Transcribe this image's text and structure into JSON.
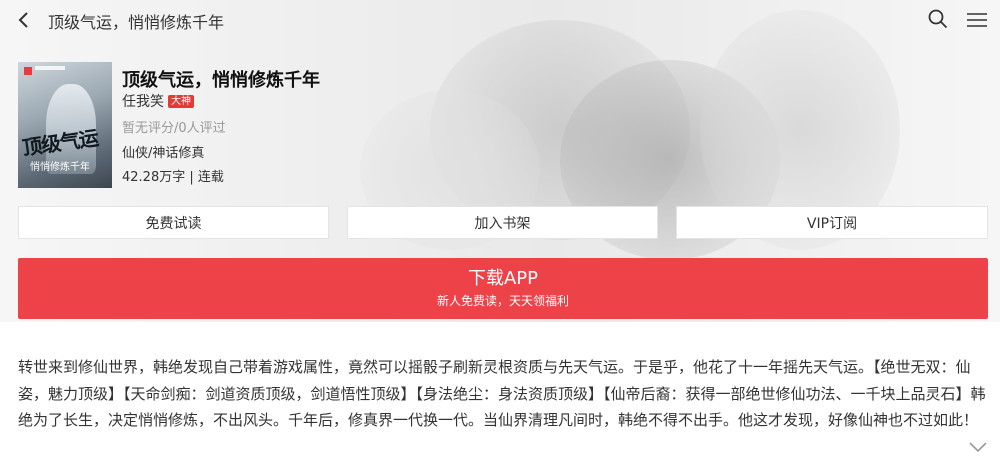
{
  "nav": {
    "title": "顶级气运，悄悄修炼千年",
    "icons": {
      "back": "chevron-left-icon",
      "search": "search-icon",
      "menu": "menu-icon"
    }
  },
  "book": {
    "title": "顶级气运，悄悄修炼千年",
    "author": "任我笑",
    "author_badge": "大神",
    "rating": "暂无评分/0人评过",
    "genre": "仙侠/神话修真",
    "stats": "42.28万字 | 连载",
    "cover": {
      "title_art": "顶级气运",
      "subtitle": "悄悄修炼千年"
    }
  },
  "actions": {
    "free_read": "免费试读",
    "add_shelf": "加入书架",
    "vip": "VIP订阅"
  },
  "download": {
    "label": "下载APP",
    "sub": "新人免费读，天天领福利"
  },
  "intro": {
    "text": "转世来到修仙世界，韩绝发现自己带着游戏属性，竟然可以摇骰子刷新灵根资质与先天气运。于是乎，他花了十一年摇先天气运。【绝世无双：仙姿，魅力顶级】【天命剑痴：剑道资质顶级，剑道悟性顶级】【身法绝尘：身法资质顶级】【仙帝后裔：获得一部绝世修仙功法、一千块上品灵石】韩绝为了长生，决定悄悄修炼，不出风头。千年后，修真界一代换一代。当仙界清理凡间时，韩绝不得不出手。他这才发现，好像仙神也不过如此！"
  },
  "colors": {
    "accent": "#ee4249",
    "badge": "#e53935",
    "muted": "#999999"
  }
}
